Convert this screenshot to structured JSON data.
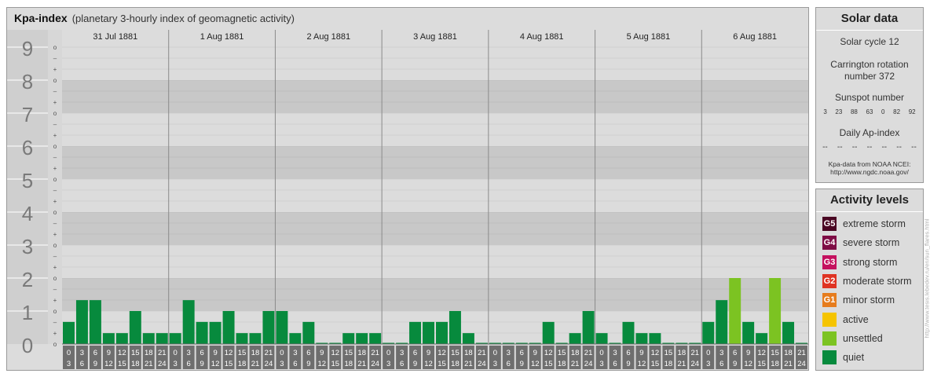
{
  "header": {
    "title": "Kpa-index",
    "subtitle": "(planetary 3-hourly index of geomagnetic activity)"
  },
  "chart_data": {
    "type": "bar",
    "title": "Kpa-index",
    "subtitle": "(planetary 3-hourly index of geomagnetic activity)",
    "ylim": [
      0,
      9
    ],
    "y_ticks": [
      "0",
      "1",
      "2",
      "3",
      "4",
      "5",
      "6",
      "7",
      "8",
      "9"
    ],
    "minor_ticks": [
      "–",
      "o",
      "+"
    ],
    "days": [
      "31 Jul 1881",
      "1 Aug 1881",
      "2 Aug 1881",
      "3 Aug 1881",
      "4 Aug 1881",
      "5 Aug 1881",
      "6 Aug 1881"
    ],
    "intervals": [
      [
        "0",
        "3"
      ],
      [
        "3",
        "6"
      ],
      [
        "6",
        "9"
      ],
      [
        "9",
        "12"
      ],
      [
        "12",
        "15"
      ],
      [
        "15",
        "18"
      ],
      [
        "18",
        "21"
      ],
      [
        "21",
        "24"
      ]
    ],
    "values": [
      [
        0.67,
        1.33,
        1.33,
        0.33,
        0.33,
        1.0,
        0.33,
        0.33
      ],
      [
        0.33,
        1.33,
        0.67,
        0.67,
        1.0,
        0.33,
        0.33,
        1.0
      ],
      [
        1.0,
        0.33,
        0.67,
        0.0,
        0.0,
        0.33,
        0.33,
        0.33
      ],
      [
        0.0,
        0.0,
        0.67,
        0.67,
        0.67,
        1.0,
        0.33,
        0.0
      ],
      [
        0.0,
        0.0,
        0.0,
        0.0,
        0.67,
        0.0,
        0.33,
        1.0
      ],
      [
        0.33,
        0.0,
        0.67,
        0.33,
        0.33,
        0.0,
        0.0,
        0.0
      ],
      [
        0.67,
        1.33,
        2.0,
        0.67,
        0.33,
        2.0,
        0.67,
        0.0
      ]
    ],
    "colors": {
      "quiet": "#078a3d",
      "unsettled": "#7cc322"
    }
  },
  "solar": {
    "heading": "Solar data",
    "cycle": "Solar cycle 12",
    "carrington": "Carrington rotation number 372",
    "sunspot_label": "Sunspot number",
    "sunspot_values": [
      "3",
      "23",
      "88",
      "63",
      "0",
      "82",
      "92"
    ],
    "ap_label": "Daily Ap-index",
    "ap_values": [
      "--",
      "--",
      "--",
      "--",
      "--",
      "--",
      "--"
    ],
    "credit_line1": "Kpa-data from NOAA NCEI:",
    "credit_line2": "http://www.ngdc.noaa.gov/"
  },
  "levels": {
    "heading": "Activity levels",
    "items": [
      {
        "badge": "G5",
        "label": "extreme storm",
        "color": "#4a0723"
      },
      {
        "badge": "G4",
        "label": "severe storm",
        "color": "#7e0c45"
      },
      {
        "badge": "G3",
        "label": "strong storm",
        "color": "#c4115e"
      },
      {
        "badge": "G2",
        "label": "moderate storm",
        "color": "#df3322"
      },
      {
        "badge": "G1",
        "label": "minor storm",
        "color": "#e67c1d"
      },
      {
        "badge": "",
        "label": "active",
        "color": "#f5c400"
      },
      {
        "badge": "",
        "label": "unsettled",
        "color": "#7cc322"
      },
      {
        "badge": "",
        "label": "quiet",
        "color": "#078a3d"
      }
    ]
  },
  "watermark": "http://www.tesis.lebedev.ru/en/sun_flares.html"
}
